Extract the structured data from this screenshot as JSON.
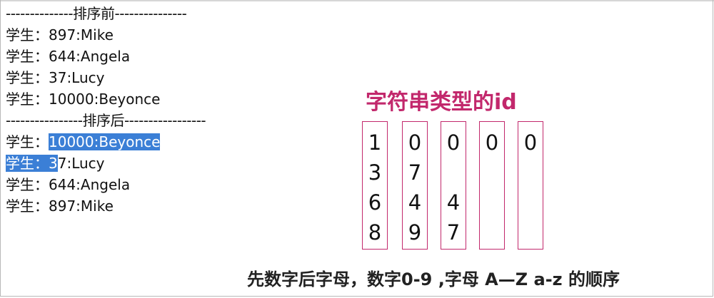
{
  "console": {
    "before_header": "--------------排序前---------------",
    "before": [
      "学生：897:Mike",
      "学生：644:Angela",
      "学生：37:Lucy",
      "学生：10000:Beyonce"
    ],
    "after_header": "----------------排序后-----------------",
    "after": [
      {
        "prefix": "学生：",
        "value": "10000:Beyonce"
      },
      {
        "prefix": "学生：3",
        "value": "7:Lucy"
      },
      {
        "prefix": "学生：",
        "value": "644:Angela"
      },
      {
        "prefix": "学生：",
        "value": "897:Mike"
      }
    ]
  },
  "diagram": {
    "title": "字符串类型的id",
    "columns": [
      [
        "1",
        "3",
        "6",
        "8"
      ],
      [
        "0",
        "7",
        "4",
        "9"
      ],
      [
        "0",
        "",
        "4",
        "7"
      ],
      [
        "0",
        "",
        "",
        ""
      ],
      [
        "0",
        "",
        "",
        ""
      ]
    ]
  },
  "note": "先数字后字母，数字0-9 ,字母 A—Z a-z 的顺序",
  "colors": {
    "accent": "#c2286c",
    "selection": "#3b7fd6"
  }
}
